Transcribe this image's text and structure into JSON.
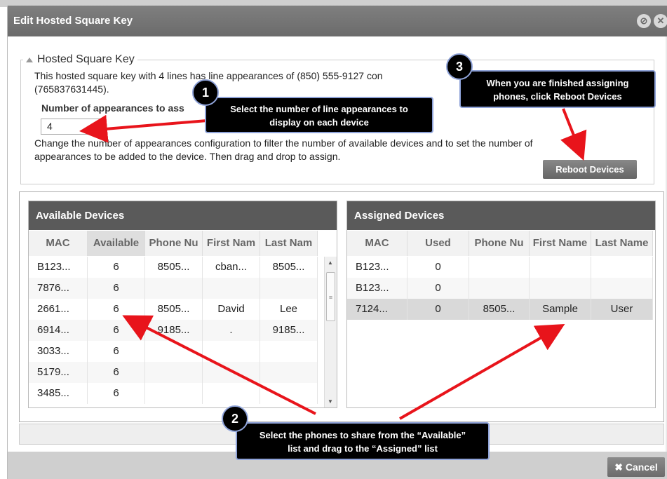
{
  "window": {
    "title": "Edit Hosted Square Key",
    "title_icons": [
      "settings-icon",
      "close-icon"
    ]
  },
  "section": {
    "legend": "Hosted Square Key",
    "description_line1": "This hosted square key with 4 lines has line appearances of (850) 555-9127 con",
    "description_line2": "(765837631445).",
    "appearances_label": "Number of appearances to ass",
    "appearances_value": "4",
    "change_text_line1": "Change the number of appearances configuration to filter the number of available devices and to set the number of",
    "change_text_line2": "appearances to be added to the device. Then drag and drop to assign.",
    "reboot_button": "Reboot Devices"
  },
  "available": {
    "title": "Available Devices",
    "columns": [
      "MAC",
      "Available",
      "Phone Nu",
      "First Nam",
      "Last Nam"
    ],
    "rows": [
      [
        "B123...",
        "6",
        "8505...",
        "cban...",
        "8505..."
      ],
      [
        "7876...",
        "6",
        "",
        "",
        ""
      ],
      [
        "2661...",
        "6",
        "8505...",
        "David",
        "Lee"
      ],
      [
        "6914...",
        "6",
        "9185...",
        ".",
        "9185..."
      ],
      [
        "3033...",
        "6",
        "",
        "",
        ""
      ],
      [
        "5179...",
        "6",
        "",
        "",
        ""
      ],
      [
        "3485...",
        "6",
        "",
        "",
        ""
      ]
    ]
  },
  "assigned": {
    "title": "Assigned Devices",
    "columns": [
      "MAC",
      "Used",
      "Phone Nu",
      "First Name",
      "Last Name"
    ],
    "rows": [
      [
        "B123...",
        "0",
        "",
        "",
        ""
      ],
      [
        "B123...",
        "0",
        "",
        "",
        ""
      ],
      [
        "7124...",
        "0",
        "8505...",
        "Sample",
        "User"
      ]
    ]
  },
  "footer": {
    "cancel_button": "Cancel"
  },
  "callouts": {
    "one": {
      "number": "1",
      "line1": "Select the number of line appearances to",
      "line2": "display on each device"
    },
    "two": {
      "number": "2",
      "line1": "Select the phones to share from the “Available”",
      "line2": "list and drag to the “Assigned” list"
    },
    "three": {
      "number": "3",
      "line1": "When you are finished assigning",
      "line2": "phones, click  Reboot Devices"
    }
  },
  "colors": {
    "arrow": "#e8141b",
    "callout_border": "#8fa3d9",
    "header": "#5a5a5a"
  }
}
